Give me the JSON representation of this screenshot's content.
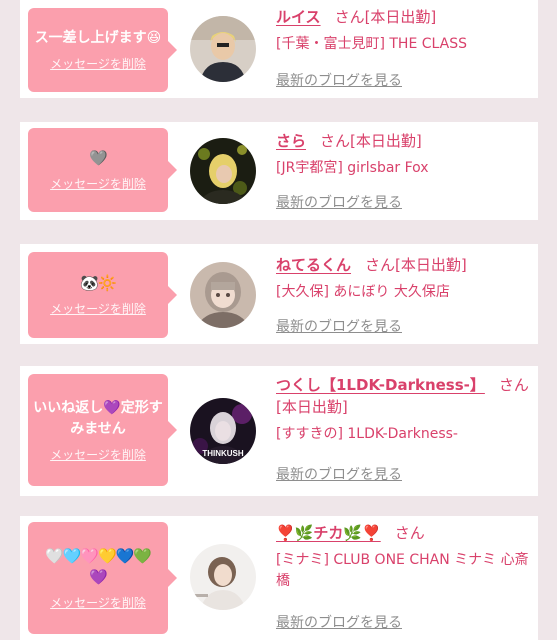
{
  "delete_label": "メッセージを削除",
  "honorific": "さん",
  "blog_label": "最新のブログを見る",
  "cards": [
    {
      "message": "ス一差し上げます😆",
      "name": "ルイス",
      "status": "[本日出勤]",
      "area": "[千葉・富士見町] THE CLASS"
    },
    {
      "message": "🩶",
      "name": "さら",
      "status": "[本日出勤]",
      "area": "[JR宇都宮] girlsbar Fox"
    },
    {
      "message": "🐼🔆",
      "name": "ねてるくん",
      "status": "[本日出勤]",
      "area": "[大久保] あにぼり 大久保店"
    },
    {
      "message": "いいね返し💜定形すみません",
      "name": "つくし【1LDK-Darkness-】",
      "status": "[本日出勤]",
      "area": "[すすきの] 1LDK-Darkness-",
      "avatar_text": "THINKUSH"
    },
    {
      "message": "🤍🩵🩷💛💙💚💜",
      "name": "❣️🌿チカ🌿❣️",
      "status": "",
      "area": "[ミナミ] CLUB ONE CHAN ミナミ 心斎橋"
    }
  ],
  "colors": {
    "accent": "#d9416b",
    "bubble": "#fb9fad",
    "background": "#efe6e9",
    "link_gray": "#8e8e8e"
  }
}
